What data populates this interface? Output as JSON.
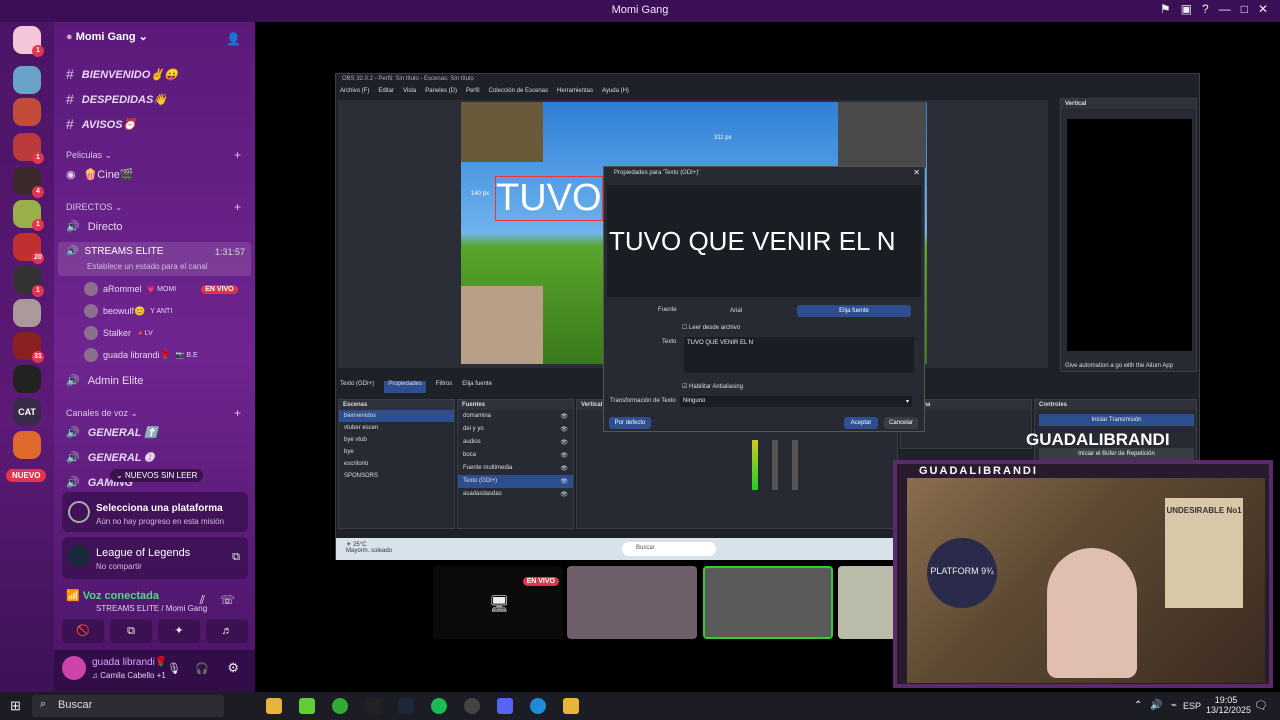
{
  "window": {
    "title": "Momi Gang"
  },
  "server": {
    "name": "Momi Gang",
    "new_badge": "NUEVO",
    "cat_label": "CAT",
    "badges": [
      "1",
      "1",
      "1",
      "4",
      "1",
      "20",
      "1",
      "31"
    ]
  },
  "channels": {
    "text": [
      {
        "name": "BIENVENIDO✌😛"
      },
      {
        "name": "DESPEDIDAS👋"
      },
      {
        "name": "AVISOS⏰"
      }
    ],
    "cat_peliculas": "Peliculas",
    "cine": "🍿Cine🎬",
    "cat_directos": "DIRECTOS",
    "directo": "Directo",
    "streams": {
      "name": "STREAMS ELITE",
      "time": "1:31:57",
      "status": "Establece un estado para el canal"
    },
    "voice_users": [
      {
        "name": "aRommel",
        "tag": "💗 MOMI",
        "live": "EN VIVO"
      },
      {
        "name": "beowulf😊",
        "tag": "Y ANTI"
      },
      {
        "name": "Stalker",
        "tag": "🔺LV"
      },
      {
        "name": "guada librandi🌹",
        "tag": "📷 B.E"
      }
    ],
    "admin": "Admin Elite",
    "cat_voz": "Canales de voz",
    "voice": [
      {
        "name": "GENERAL ⬆️"
      },
      {
        "name": "GENERAL ➊"
      },
      {
        "name": "GAMING"
      }
    ],
    "new_unread": "NUEVOS SIN LEER"
  },
  "panels": {
    "platform_title": "Selecciona una plataforma",
    "platform_sub": "Aún no hay progreso en esta misión",
    "game_title": "League of Legends",
    "game_sub": "No compartir",
    "voice_title": "Voz conectada",
    "voice_sub": "STREAMS ELITE / Momi Gang",
    "user": "guada librandi🌹",
    "user_status": "♫ Camila Cabello +1"
  },
  "obs": {
    "title": "OBS 32.0.2 - Perfil: Sin título - Escenas: Sin título",
    "menu": [
      "Archivo (F)",
      "Editar",
      "Vista",
      "Paneles (D)",
      "Perfil",
      "Colección de Escenas",
      "Herramientas",
      "Ayuda (H)"
    ],
    "canvas_text": "TUVO",
    "px_top": "311 px",
    "px_left": "140 px",
    "vertical": "Vertical",
    "source_bar": {
      "name": "Texto (GDI+)",
      "props": "Propiedades",
      "filters": "Filtros",
      "font": "Elija fuente"
    },
    "scenes_title": "Escenas",
    "scenes": [
      "bienvenidos",
      "vtuber escen",
      "bye vtub",
      "bye",
      "escritorio",
      "SPONSORS"
    ],
    "sources_title": "Fuentes",
    "sources": [
      "domamina",
      "dei y yo",
      "audios",
      "boca",
      "Fuente multimedia",
      "Texto (GDI+)",
      "asadasdasdas"
    ],
    "vertical_title": "Vertical",
    "scene_trans": "a escena",
    "controls_title": "Controles",
    "start_stream": "Iniciar Transmisión",
    "replay": "Iniciar el Búfer de Repetición",
    "aitum": "Give automation a go with the Aitum App",
    "temp": "25°C",
    "weather": "Mayorm. soleado",
    "taskbar_search": "Buscar"
  },
  "dialog": {
    "title": "Propiedades para 'Texto (GDI+)'",
    "preview": "TUVO QUE VENIR EL N",
    "font_label": "Fuente",
    "font_value": "Arial",
    "font_btn": "Elija fuente",
    "read_file": "Leer desde archivo",
    "text_label": "Texto",
    "text_value": "TUVO QUE VENIR EL N",
    "antialias": "Habilitar Antialiasing",
    "transform_label": "Transformación de Texto",
    "transform_value": "Ninguno",
    "default_btn": "Por defecto",
    "accept": "Aceptar",
    "cancel": "Cancelar"
  },
  "stream": {
    "live": "EN VIVO",
    "streamer": "GUADALIBRANDI",
    "webcam_name": "GUADALIBRANDI",
    "poster": "UNDESIRABLE No1",
    "platform": "PLATFORM 9¾"
  },
  "taskbar": {
    "search": "Buscar",
    "lang": "ESP",
    "time": "19:05",
    "date": "13/12/2025"
  }
}
